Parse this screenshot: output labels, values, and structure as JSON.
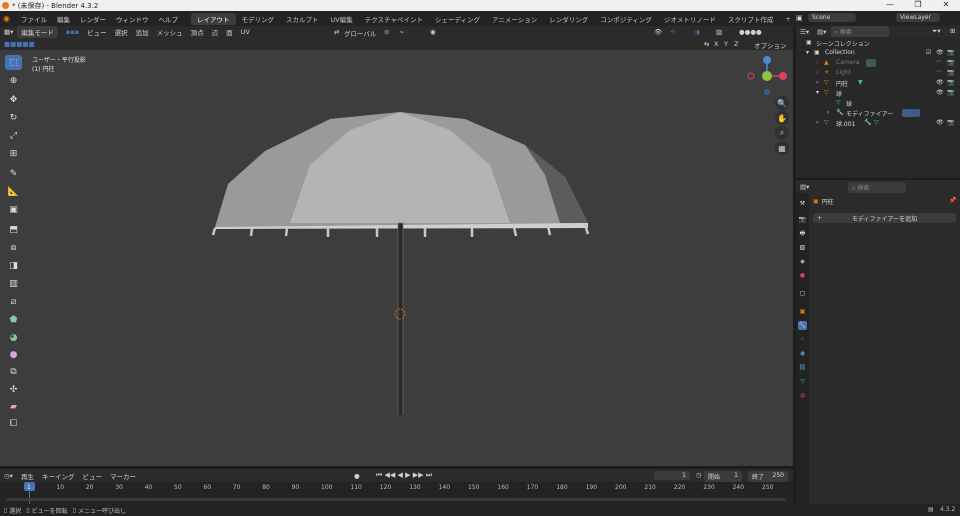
{
  "titlebar": {
    "title": "* (未保存) - Blender 4.3.2",
    "minimize": "—",
    "maximize": "❐",
    "close": "✕"
  },
  "menu": [
    "ファイル",
    "編集",
    "レンダー",
    "ウィンドウ",
    "ヘルプ"
  ],
  "workspaces": [
    "レイアウト",
    "モデリング",
    "スカルプト",
    "UV編集",
    "テクスチャペイント",
    "シェーディング",
    "アニメーション",
    "レンダリング",
    "コンポジティング",
    "ジオメトリノード",
    "スクリプト作成"
  ],
  "workspace_add": "+",
  "scene": {
    "label": "Scene",
    "view_layer": "ViewLayer"
  },
  "viewport_header": {
    "mode": "編集モード",
    "menus": [
      "ビュー",
      "選択",
      "追加",
      "メッシュ",
      "頂点",
      "辺",
      "面",
      "UV"
    ],
    "transform_orientation": "グローバル",
    "options": "オプション",
    "axes": [
      "X",
      "Y",
      "Z"
    ]
  },
  "viewport": {
    "view_name": "ユーザー・平行投影",
    "object_name": "(1) 円柱"
  },
  "tools": [
    "select-box",
    "cursor",
    "move",
    "rotate",
    "scale",
    "transform",
    "annotate",
    "measure",
    "add-cube",
    "extrude",
    "inset",
    "bevel",
    "loop-cut",
    "knife",
    "poly-build",
    "spin",
    "smooth",
    "edge-slide",
    "shrink",
    "shear",
    "rip"
  ],
  "timeline": {
    "menus": [
      "再生",
      "キーイング",
      "ビュー",
      "マーカー"
    ],
    "current_frame": "1",
    "start_label": "開始",
    "start": "1",
    "end_label": "終了",
    "end": "250",
    "ticks": [
      "1",
      "10",
      "20",
      "30",
      "40",
      "50",
      "60",
      "70",
      "80",
      "90",
      "100",
      "110",
      "120",
      "130",
      "140",
      "150",
      "160",
      "170",
      "180",
      "190",
      "200",
      "210",
      "220",
      "230",
      "240",
      "250"
    ]
  },
  "statusbar": {
    "select": "選択",
    "rotate_view": "ビューを回転",
    "menu": "メニュー呼び出し",
    "version": "4.3.2"
  },
  "outliner": {
    "search_placeholder": "検索",
    "scene_collection": "シーンコレクション",
    "items": [
      {
        "name": "Collection",
        "indent": 1,
        "color": "#d8d8d8"
      },
      {
        "name": "Camera",
        "indent": 2,
        "color": "#7a7a7a"
      },
      {
        "name": "Light",
        "indent": 2,
        "color": "#7a7a7a"
      },
      {
        "name": "円柱",
        "indent": 2,
        "color": "#d8d8d8"
      },
      {
        "name": "球",
        "indent": 2,
        "color": "#d8d8d8"
      },
      {
        "name": "球",
        "indent": 3,
        "color": "#d8d8d8"
      },
      {
        "name": "モディファイアー",
        "indent": 3,
        "color": "#d8d8d8"
      },
      {
        "name": "球.001",
        "indent": 2,
        "color": "#d8d8d8"
      }
    ]
  },
  "properties": {
    "search_placeholder": "検索",
    "object_name": "円柱",
    "add_modifier": "モディファイアーを追加"
  },
  "colors": {
    "accent": "#4772b3",
    "orange": "#e87d0d",
    "viewport_bg": "#3d3d3d"
  }
}
